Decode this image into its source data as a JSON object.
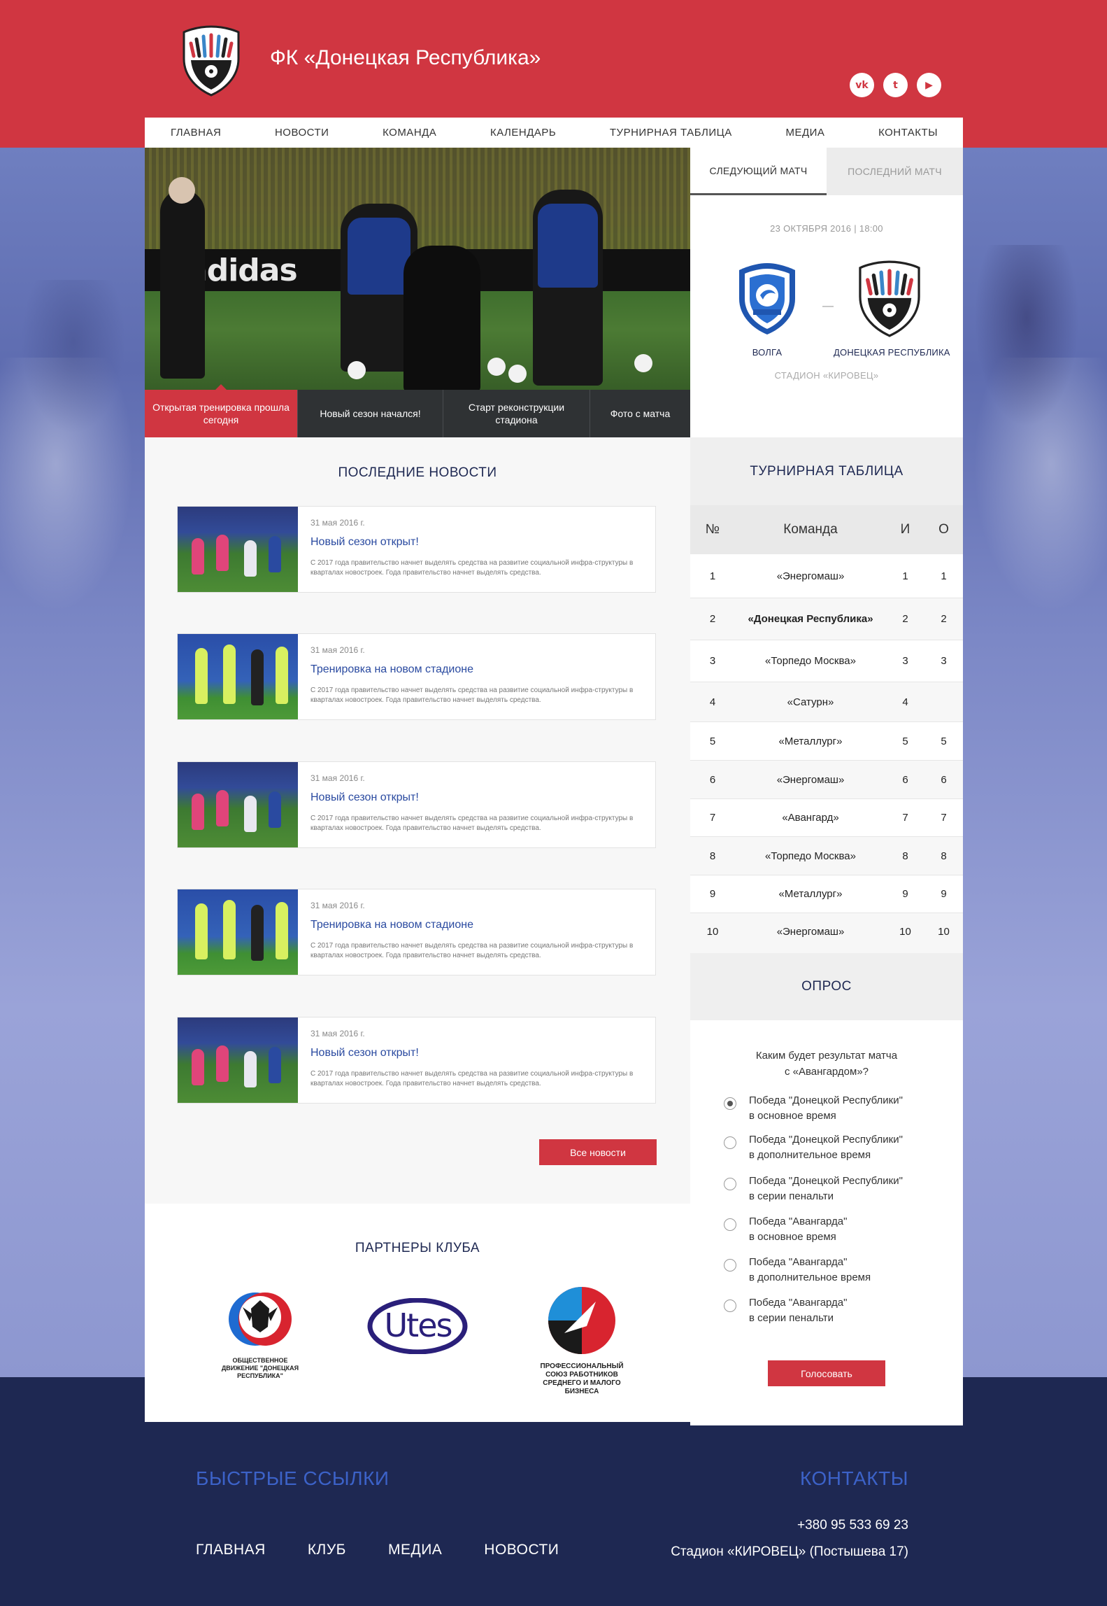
{
  "header": {
    "site_title": "ФК «Донецкая Республика»",
    "socials": [
      {
        "name": "vk-icon",
        "glyph": "vk"
      },
      {
        "name": "twitter-icon",
        "glyph": "t"
      },
      {
        "name": "youtube-icon",
        "glyph": "▶"
      }
    ]
  },
  "nav": {
    "items": [
      "ГЛАВНАЯ",
      "НОВОСТИ",
      "КОМАНДА",
      "КАЛЕНДАРЬ",
      "ТУРНИРНАЯ ТАБЛИЦА",
      "МЕДИА",
      "КОНТАКТЫ"
    ]
  },
  "hero": {
    "board_text": "adidas",
    "tabs": [
      "Открытая тренировка прошла сегодня",
      "Новый сезон начался!",
      "Старт реконструкции стадиона",
      "Фото с матча"
    ]
  },
  "match": {
    "tab_next": "СЛЕДУЮЩИЙ МАТЧ",
    "tab_last": "ПОСЛЕДНИЙ МАТЧ",
    "date": "23 ОКТЯБРЯ 2016 | 18:00",
    "home": "ВОЛГА",
    "away": "ДОНЕЦКАЯ РЕСПУБЛИКА",
    "vs": "—",
    "stadium": "СТАДИОН «КИРОВЕЦ»"
  },
  "news": {
    "title": "ПОСЛЕДНИЕ НОВОСТИ",
    "items": [
      {
        "date": "31 мая 2016 г.",
        "headline": "Новый сезон открыт!",
        "text": "С 2017 года правительство начнет выделять средства на развитие социальной инфра-структуры в кварталах новостроек. Года правительство начнет выделять средства."
      },
      {
        "date": "31 мая 2016 г.",
        "headline": "Тренировка на новом стадионе",
        "text": "С 2017 года правительство начнет выделять средства на развитие социальной инфра-структуры в кварталах новостроек. Года правительство начнет выделять средства."
      },
      {
        "date": "31 мая 2016 г.",
        "headline": "Новый сезон открыт!",
        "text": "С 2017 года правительство начнет выделять средства на развитие социальной инфра-структуры в кварталах новостроек. Года правительство начнет выделять средства."
      },
      {
        "date": "31 мая 2016 г.",
        "headline": "Тренировка на новом стадионе",
        "text": "С 2017 года правительство начнет выделять средства на развитие социальной инфра-структуры в кварталах новостроек. Года правительство начнет выделять средства."
      },
      {
        "date": "31 мая 2016 г.",
        "headline": "Новый сезон открыт!",
        "text": "С 2017 года правительство начнет выделять средства на развитие социальной инфра-структуры в кварталах новостроек. Года правительство начнет выделять средства."
      }
    ],
    "all_button": "Все новости"
  },
  "partners": {
    "title": "ПАРТНЕРЫ КЛУБА",
    "p1_caption": "ОБЩЕСТВЕННОЕ ДВИЖЕНИЕ \"ДОНЕЦКАЯ РЕСПУБЛИКА\"",
    "p2_text": "Utes",
    "p3_caption": "ПРОФЕССИОНАЛЬНЫЙ СОЮЗ РАБОТНИКОВ СРЕДНЕГО И МАЛОГО БИЗНЕСА"
  },
  "standings": {
    "title": "ТУРНИРНАЯ ТАБЛИЦА",
    "headers": {
      "num": "№",
      "team": "Команда",
      "games": "И",
      "points": "О"
    },
    "rows": [
      {
        "num": "1",
        "team": "«Энергомаш»",
        "games": "1",
        "points": "1"
      },
      {
        "num": "2",
        "team": "«Донецкая Республика»",
        "games": "2",
        "points": "2"
      },
      {
        "num": "3",
        "team": "«Торпедо Москва»",
        "games": "3",
        "points": "3"
      },
      {
        "num": "4",
        "team": "«Сатурн»",
        "games": "4",
        "points": ""
      },
      {
        "num": "5",
        "team": "«Металлург»",
        "games": "5",
        "points": "5"
      },
      {
        "num": "6",
        "team": "«Энергомаш»",
        "games": "6",
        "points": "6"
      },
      {
        "num": "7",
        "team": "«Авангард»",
        "games": "7",
        "points": "7"
      },
      {
        "num": "8",
        "team": "«Торпедо Москва»",
        "games": "8",
        "points": "8"
      },
      {
        "num": "9",
        "team": "«Металлург»",
        "games": "9",
        "points": "9"
      },
      {
        "num": "10",
        "team": "«Энергомаш»",
        "games": "10",
        "points": "10"
      }
    ]
  },
  "poll": {
    "title": "ОПРОС",
    "question": "Каким будет результат матча\nс «Авангардом»?",
    "options": [
      {
        "label": "Победа \"Донецкой Республики\"\nв основное время",
        "checked": true
      },
      {
        "label": "Победа \"Донецкой Республики\"\nв дополнительное время",
        "checked": false
      },
      {
        "label": "Победа \"Донецкой Республики\"\nв серии пенальти",
        "checked": false
      },
      {
        "label": "Победа \"Авангарда\"\nв основное время",
        "checked": false
      },
      {
        "label": "Победа \"Авангарда\"\nв дополнительное время",
        "checked": false
      },
      {
        "label": "Победа \"Авангарда\"\nв серии пенальти",
        "checked": false
      }
    ],
    "vote_button": "Голосовать"
  },
  "footer": {
    "quick_links_title": "БЫСТРЫЕ ССЫЛКИ",
    "links": [
      "ГЛАВНАЯ",
      "КЛУБ",
      "МЕДИА",
      "НОВОСТИ"
    ],
    "contacts_title": "КОНТАКТЫ",
    "phone": "+380 95 533 69 23",
    "address": "Стадион «КИРОВЕЦ» (Постышева 17)"
  },
  "colors": {
    "brand_red": "#d03641",
    "footer_navy": "#1e2852",
    "link_blue": "#2a4aa0",
    "footer_heading_blue": "#3c62c8"
  }
}
